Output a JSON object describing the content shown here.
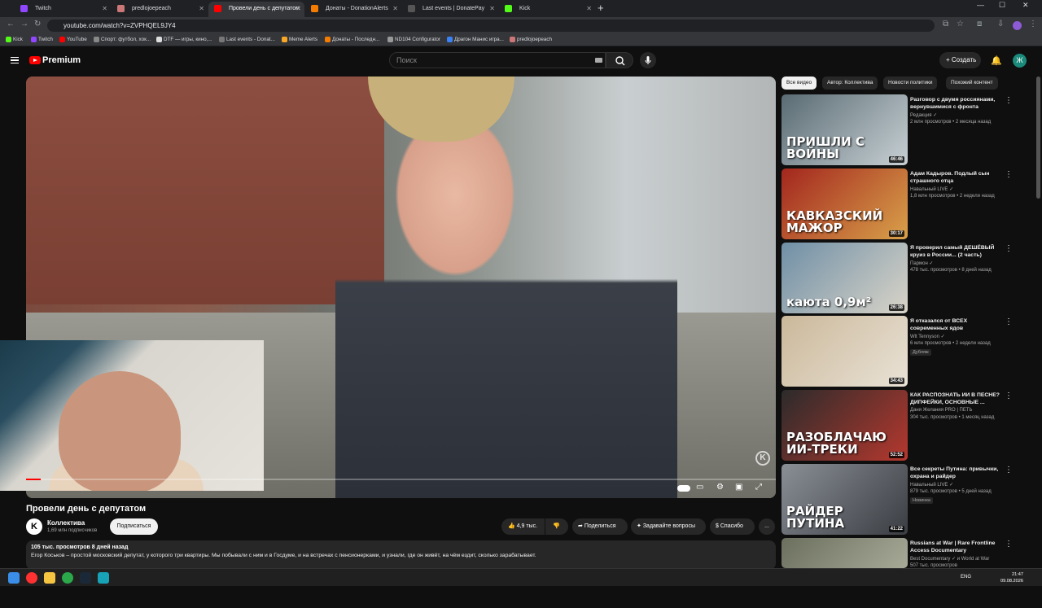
{
  "browser": {
    "tabs": [
      {
        "label": "Twitch",
        "color": "#9146ff"
      },
      {
        "label": "predlojoepeach",
        "color": "#c77"
      },
      {
        "label": "Провели день с депутатом",
        "color": "#ff0000"
      },
      {
        "label": "Донаты - DonationAlerts",
        "color": "#f57c00"
      },
      {
        "label": "Last events | DonatePay",
        "color": "#555"
      },
      {
        "label": "Kick",
        "color": "#53fc18"
      }
    ],
    "url": "youtube.com/watch?v=ZVPHQEL9JY4",
    "bookmarks": [
      {
        "label": "Kick",
        "color": "#53fc18"
      },
      {
        "label": "Twitch",
        "color": "#9146ff"
      },
      {
        "label": "YouTube",
        "color": "#ff0000"
      },
      {
        "label": "Спорт: футбол, хок...",
        "color": "#888"
      },
      {
        "label": "DTF — игры, кино,...",
        "color": "#ddd"
      },
      {
        "label": "Last events - Donat...",
        "color": "#777"
      },
      {
        "label": "Meme Alerts",
        "color": "#f9a825"
      },
      {
        "label": "Донаты - Последн...",
        "color": "#f57c00"
      },
      {
        "label": "ND104 Configurator",
        "color": "#999"
      },
      {
        "label": "Драгон Манис игра...",
        "color": "#3b82f6"
      },
      {
        "label": "predlojoepeach",
        "color": "#c77"
      }
    ]
  },
  "header": {
    "brand": "Premium",
    "search_placeholder": "Поиск",
    "create_label": "Создать",
    "avatar_letter": "Ж"
  },
  "video": {
    "title": "Провели день с депутатом",
    "progress": 0.02,
    "channel": {
      "name": "Коллектива",
      "subs": "1,69 млн подписчиков",
      "avatar_letter": "K"
    },
    "subscribe_label": "Подписаться",
    "actions": {
      "likes": "4,9 тыс.",
      "share": "Поделиться",
      "ask": "Задавайте вопросы",
      "thanks": "Спасибо",
      "more": "..."
    },
    "description": {
      "meta": "105 тыс. просмотров  8 дней назад",
      "text": "Егор Коськов – простой московский депутат, у которого три квартиры. Мы побывали с ним и в Госдуме, и на встречах с пенсионерками, и узнали, где он живёт, на чём ездит, сколько зарабатывает."
    }
  },
  "sidebar": {
    "chips": [
      "Все видео",
      "Автор: Коллектива",
      "Новости политики",
      "Похожий контент"
    ],
    "recs": [
      {
        "title": "Разговор с двумя россиянами, вернувшимися с фронта",
        "channel": "Редакция ✓",
        "meta": "2 млн просмотров • 2 месяца назад",
        "duration": "46:46",
        "thumb_text": "ПРИШЛИ С ВОЙНЫ",
        "badge": "",
        "color1": "#5a6b73",
        "color2": "#c7d0d4"
      },
      {
        "title": "Адам Кадыров. Подлый сын страшного отца",
        "channel": "Навальный LIVE ✓",
        "meta": "1,8 млн просмотров • 2 недели назад",
        "duration": "30:17",
        "thumb_text": "КАВКАЗСКИЙ МАЖОР",
        "badge": "",
        "color1": "#a3261e",
        "color2": "#d9a14a"
      },
      {
        "title": "Я проверил самый ДЕШЁВЫЙ круиз в России... (2 часть)",
        "channel": "Пармон ✓",
        "meta": "478 тыс. просмотров • 8 дней назад",
        "duration": "26:38",
        "thumb_text": "каюта 0,9м²",
        "badge": "",
        "color1": "#6f8fa6",
        "color2": "#d9d4c8"
      },
      {
        "title": "Я отказался от ВСЕХ современных ядов",
        "channel": "Wlt Tennyson ✓",
        "meta": "6 млн просмотров • 2 недели назад",
        "duration": "34:43",
        "thumb_text": "",
        "badge": "Дубляж",
        "color1": "#cbb89a",
        "color2": "#e9e2d6"
      },
      {
        "title": "КАК РАСПОЗНАТЬ ИИ В ПЕСНЕ? ДИПФЕЙКИ, ОСНОВНЫЕ ...",
        "channel": "Даня Желания PRO | ПЕТЬ",
        "meta": "304 тыс. просмотров • 1 месяц назад",
        "duration": "52:52",
        "thumb_text": "РАЗОБЛАЧАЮ ИИ-ТРЕКИ",
        "badge": "",
        "color1": "#2b2b2b",
        "color2": "#b5382e"
      },
      {
        "title": "Все секреты Путина: привычки, охрана и райдер",
        "channel": "Навальный LIVE ✓",
        "meta": "879 тыс. просмотров • 5 дней назад",
        "duration": "41:22",
        "thumb_text": "РАЙДЕР ПУТИНА",
        "badge": "Новинка",
        "color1": "#8a8f96",
        "color2": "#3a3d42"
      },
      {
        "title": "Russians at War | Rare Frontline Access Documentary",
        "channel": "Best Documentary ✓ и World at War",
        "meta": "507 тыс. просмотров",
        "duration": "",
        "thumb_text": "",
        "badge": "",
        "color1": "#6b6f5d",
        "color2": "#a8aa98"
      }
    ]
  },
  "taskbar": {
    "lang": "ENG",
    "time": "21:47",
    "date": "09.08.2026"
  }
}
